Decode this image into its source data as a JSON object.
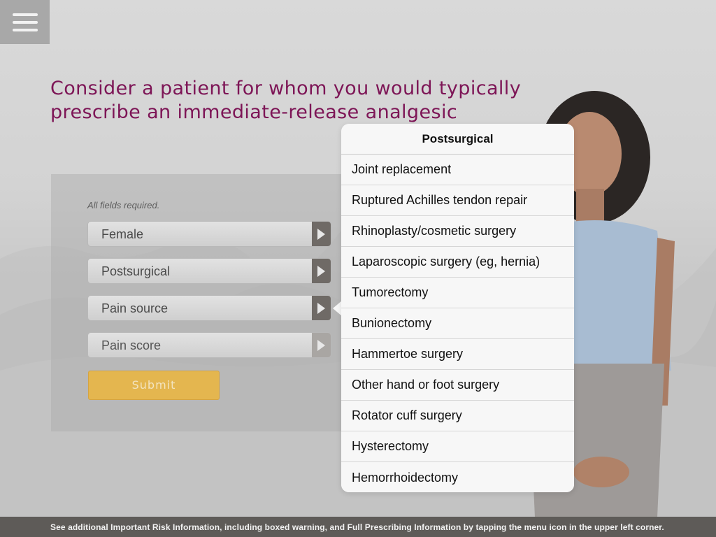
{
  "headline": {
    "line1": "Consider a patient for whom you would typically",
    "line2": "prescribe an immediate-release analgesic"
  },
  "form": {
    "required_note": "All fields required.",
    "fields": [
      {
        "label": "Female"
      },
      {
        "label": "Postsurgical"
      },
      {
        "label": "Pain source"
      },
      {
        "label": "Pain score"
      }
    ],
    "submit_label": "Submit"
  },
  "popover": {
    "title": "Postsurgical",
    "items": [
      "Joint replacement",
      "Ruptured Achilles tendon repair",
      "Rhinoplasty/cosmetic surgery",
      "Laparoscopic surgery (eg, hernia)",
      "Tumorectomy",
      "Bunionectomy",
      "Hammertoe surgery",
      "Other hand or foot surgery",
      "Rotator cuff surgery",
      "Hysterectomy",
      "Hemorrhoidectomy"
    ]
  },
  "footer": {
    "text": "See additional Important Risk Information, including boxed warning, and Full Prescribing Information by tapping the menu icon in the upper left corner."
  },
  "icons": {
    "menu": "hamburger-menu-icon",
    "field_arrow": "chevron-right-icon"
  },
  "colors": {
    "headline": "#7d1556",
    "submit": "#e4b64f",
    "footer_bg": "#5e5b58"
  }
}
